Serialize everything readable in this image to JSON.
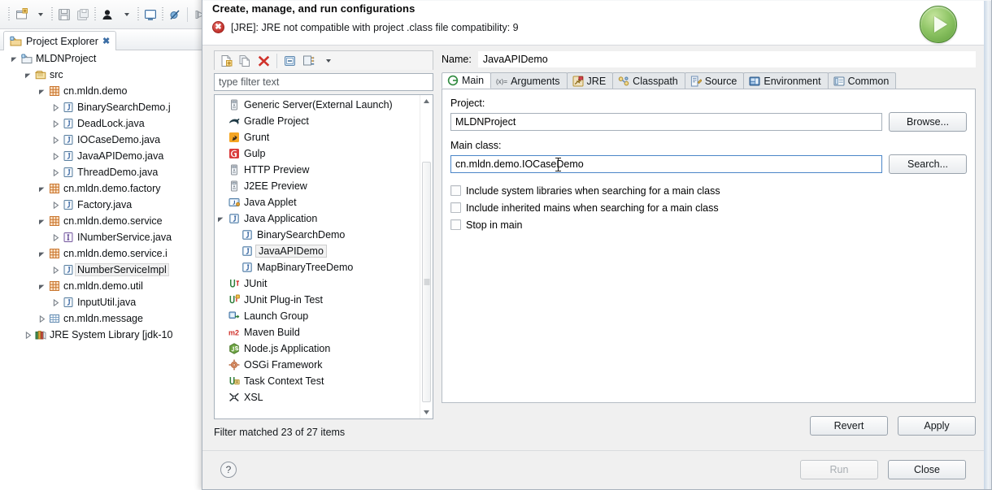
{
  "workbench": {
    "toolbar_icons": [
      "new-wizard-icon",
      "toolbar-dropdown-caret",
      "save-icon",
      "save-all-icon",
      "person-icon",
      "person-dropdown-caret",
      "open-console-icon",
      "skip-breakpoints-icon",
      "step-icon"
    ],
    "view_tab": {
      "label": "Project Explorer",
      "close_glyph": "✖",
      "icon": "project-explorer-icon"
    },
    "view_menu_icon": "collapse-all-icon",
    "tree": [
      {
        "label": "MLDNProject",
        "indent": 0,
        "twisty": "expanded",
        "icon": "java-project-icon",
        "selected": false
      },
      {
        "label": "src",
        "indent": 1,
        "twisty": "expanded",
        "icon": "source-folder-icon",
        "selected": false
      },
      {
        "label": "cn.mldn.demo",
        "indent": 2,
        "twisty": "expanded",
        "icon": "package-icon",
        "selected": false
      },
      {
        "label": "BinarySearchDemo.j",
        "indent": 3,
        "twisty": "collapsed",
        "icon": "java-class-icon",
        "selected": false
      },
      {
        "label": "DeadLock.java",
        "indent": 3,
        "twisty": "collapsed",
        "icon": "java-class-icon",
        "selected": false
      },
      {
        "label": "IOCaseDemo.java",
        "indent": 3,
        "twisty": "collapsed",
        "icon": "java-class-icon",
        "selected": false
      },
      {
        "label": "JavaAPIDemo.java",
        "indent": 3,
        "twisty": "collapsed",
        "icon": "java-class-icon",
        "selected": false
      },
      {
        "label": "ThreadDemo.java",
        "indent": 3,
        "twisty": "collapsed",
        "icon": "java-class-icon",
        "selected": false
      },
      {
        "label": "cn.mldn.demo.factory",
        "indent": 2,
        "twisty": "expanded",
        "icon": "package-icon",
        "selected": false
      },
      {
        "label": "Factory.java",
        "indent": 3,
        "twisty": "collapsed",
        "icon": "java-class-icon",
        "selected": false
      },
      {
        "label": "cn.mldn.demo.service",
        "indent": 2,
        "twisty": "expanded",
        "icon": "package-icon",
        "selected": false
      },
      {
        "label": "INumberService.java",
        "indent": 3,
        "twisty": "collapsed",
        "icon": "java-interface-icon",
        "selected": false
      },
      {
        "label": "cn.mldn.demo.service.i",
        "indent": 2,
        "twisty": "expanded",
        "icon": "package-icon",
        "selected": false
      },
      {
        "label": "NumberServiceImpl",
        "indent": 3,
        "twisty": "collapsed",
        "icon": "java-class-icon",
        "selected": true
      },
      {
        "label": "cn.mldn.demo.util",
        "indent": 2,
        "twisty": "expanded",
        "icon": "package-icon",
        "selected": false
      },
      {
        "label": "InputUtil.java",
        "indent": 3,
        "twisty": "collapsed",
        "icon": "java-class-icon",
        "selected": false
      },
      {
        "label": "cn.mldn.message",
        "indent": 2,
        "twisty": "collapsed",
        "icon": "empty-package-icon",
        "selected": false
      },
      {
        "label": "JRE System Library [jdk-10",
        "indent": 1,
        "twisty": "collapsed",
        "icon": "library-icon",
        "selected": false
      }
    ]
  },
  "dialog": {
    "title": "Create, manage, and run configurations",
    "message": "[JRE]: JRE not compatible with project .class file compatibility: 9",
    "error_icon": "error-x-icon",
    "run_icon": "run-launch-icon",
    "help_icon": "help-question-icon",
    "accent": "#4b86c8",
    "error_color": "#c0302a",
    "run_green": "#5f9e3c",
    "config_toolbar": {
      "icons": [
        "new-launch-configuration-icon",
        "duplicate-icon",
        "delete-icon",
        "collapse-all-icon",
        "filter-icon",
        "filter-dropdown-caret"
      ]
    },
    "filter": {
      "placeholder": "type filter text",
      "value": ""
    },
    "status": "Filter matched 23 of 27 items",
    "config_types": [
      {
        "label": "Generic Server(External Launch)",
        "icon": "server-icon",
        "twisty": "none",
        "child": false,
        "selected": false
      },
      {
        "label": "Gradle Project",
        "icon": "gradle-icon",
        "twisty": "none",
        "child": false,
        "selected": false
      },
      {
        "label": "Grunt",
        "icon": "grunt-icon",
        "twisty": "none",
        "child": false,
        "selected": false
      },
      {
        "label": "Gulp",
        "icon": "gulp-icon",
        "twisty": "none",
        "child": false,
        "selected": false
      },
      {
        "label": "HTTP Preview",
        "icon": "server-icon",
        "twisty": "none",
        "child": false,
        "selected": false
      },
      {
        "label": "J2EE Preview",
        "icon": "server-icon",
        "twisty": "none",
        "child": false,
        "selected": false
      },
      {
        "label": "Java Applet",
        "icon": "java-applet-icon",
        "twisty": "none",
        "child": false,
        "selected": false
      },
      {
        "label": "Java Application",
        "icon": "java-app-icon",
        "twisty": "expanded",
        "child": false,
        "selected": false
      },
      {
        "label": "BinarySearchDemo",
        "icon": "java-app-icon",
        "twisty": "none",
        "child": true,
        "selected": false
      },
      {
        "label": "JavaAPIDemo",
        "icon": "java-app-icon",
        "twisty": "none",
        "child": true,
        "selected": true
      },
      {
        "label": "MapBinaryTreeDemo",
        "icon": "java-app-icon",
        "twisty": "none",
        "child": true,
        "selected": false
      },
      {
        "label": "JUnit",
        "icon": "junit-icon",
        "twisty": "none",
        "child": false,
        "selected": false
      },
      {
        "label": "JUnit Plug-in Test",
        "icon": "junit-plugin-icon",
        "twisty": "none",
        "child": false,
        "selected": false
      },
      {
        "label": "Launch Group",
        "icon": "launch-group-icon",
        "twisty": "none",
        "child": false,
        "selected": false
      },
      {
        "label": "Maven Build",
        "icon": "maven-icon",
        "twisty": "none",
        "child": false,
        "selected": false
      },
      {
        "label": "Node.js Application",
        "icon": "nodejs-icon",
        "twisty": "none",
        "child": false,
        "selected": false
      },
      {
        "label": "OSGi Framework",
        "icon": "osgi-icon",
        "twisty": "none",
        "child": false,
        "selected": false
      },
      {
        "label": "Task Context Test",
        "icon": "task-context-icon",
        "twisty": "none",
        "child": false,
        "selected": false
      },
      {
        "label": "XSL",
        "icon": "xsl-icon",
        "twisty": "none",
        "child": false,
        "selected": false
      }
    ],
    "name": {
      "label": "Name:",
      "value": "JavaAPIDemo"
    },
    "tabs": [
      {
        "label": "Main",
        "icon": "main-tab-icon",
        "active": true
      },
      {
        "label": "Arguments",
        "icon": "arguments-tab-icon",
        "active": false
      },
      {
        "label": "JRE",
        "icon": "jre-tab-icon",
        "active": false
      },
      {
        "label": "Classpath",
        "icon": "classpath-tab-icon",
        "active": false
      },
      {
        "label": "Source",
        "icon": "source-tab-icon",
        "active": false
      },
      {
        "label": "Environment",
        "icon": "environment-tab-icon",
        "active": false
      },
      {
        "label": "Common",
        "icon": "common-tab-icon",
        "active": false
      }
    ],
    "main_tab": {
      "project_label": "Project:",
      "project_value": "MLDNProject",
      "browse_label": "Browse...",
      "main_class_label": "Main class:",
      "main_class_value": "cn.mldn.demo.IOCaseDemo",
      "search_label": "Search...",
      "checkboxes": [
        {
          "label": "Include system libraries when searching for a main class",
          "checked": false
        },
        {
          "label": "Include inherited mains when searching for a main class",
          "checked": false
        },
        {
          "label": "Stop in main",
          "checked": false
        }
      ]
    },
    "revert_label": "Revert",
    "apply_label": "Apply",
    "run_label": "Run",
    "run_enabled": false,
    "close_label": "Close"
  }
}
